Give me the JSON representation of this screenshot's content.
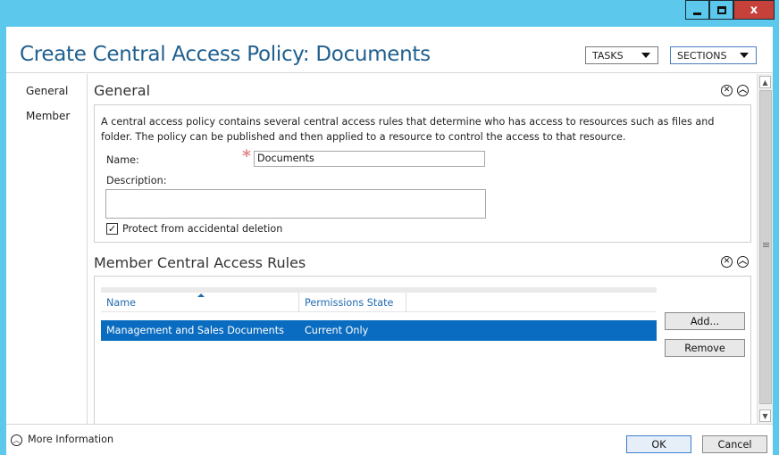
{
  "window": {
    "title": "Create Central Access Policy: Documents",
    "close_glyph": "x"
  },
  "header": {
    "tasks_label": "TASKS",
    "sections_label": "SECTIONS"
  },
  "nav": {
    "items": [
      "General",
      "Member"
    ]
  },
  "general": {
    "title": "General",
    "description": "A central access policy contains several central access rules that determine who has access to resources such as files and folder. The policy can be published and then applied to a resource to control the access to that resource.",
    "name_label": "Name:",
    "name_required_mark": "*",
    "name_value": "Documents",
    "description_label": "Description:",
    "description_value": "",
    "protect_label": "Protect from accidental deletion",
    "protect_checked": true
  },
  "member_rules": {
    "title": "Member Central Access Rules",
    "columns": [
      "Name",
      "Permissions State"
    ],
    "rows": [
      {
        "name": "Management and Sales Documents",
        "state": "Current Only",
        "selected": true
      }
    ],
    "add_label": "Add...",
    "remove_label": "Remove"
  },
  "footer": {
    "more_info_label": "More Information",
    "ok_label": "OK",
    "cancel_label": "Cancel"
  },
  "colors": {
    "titlebar": "#5cc8ec",
    "title_text": "#1f5f8f",
    "selection": "#0a6cc0",
    "close_button": "#c7413b",
    "column_header": "#1f6ab0"
  },
  "icons": {
    "section_close": "close-circle-icon",
    "section_collapse": "collapse-up-icon",
    "more_info": "expand-circle-icon",
    "dropdown": "triangle-down-icon"
  }
}
